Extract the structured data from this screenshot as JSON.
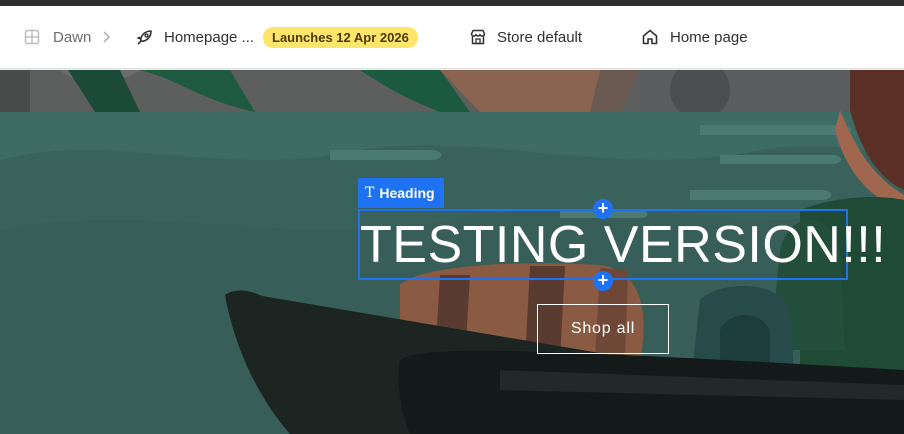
{
  "toolbar": {
    "theme_name": "Dawn",
    "template_name": "Homepage ...",
    "launch_badge": "Launches 12 Apr 2026",
    "store_label": "Store default",
    "page_label": "Home page"
  },
  "editor": {
    "selected_block_label": "Heading",
    "heading_text": "TESTING VERSION!!!",
    "button_label": "Shop all",
    "add_above": "+",
    "add_below": "+"
  },
  "colors": {
    "accent": "#1f73f2",
    "badge_bg": "#ffe66b"
  },
  "icons": {
    "theme": "layout-grid-icon",
    "separator": "chevron-right-icon",
    "template": "rocket-icon",
    "store": "store-icon",
    "page": "home-icon",
    "block_type": "text-type-icon"
  }
}
